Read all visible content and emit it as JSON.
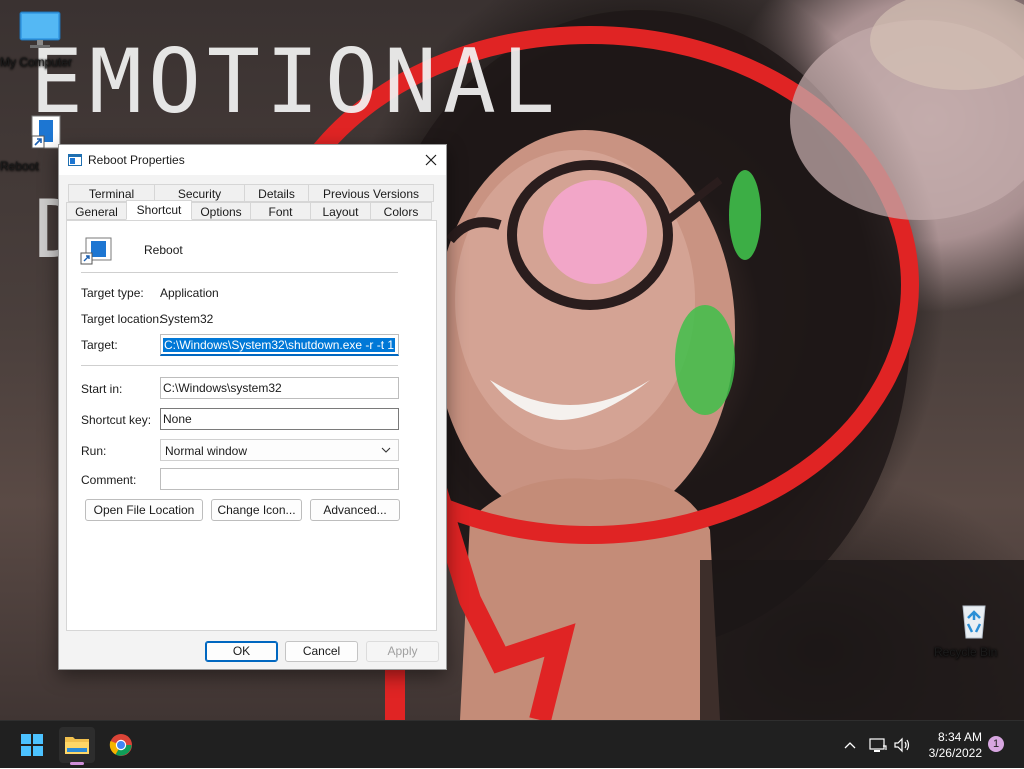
{
  "wallpaper": {
    "line1": "EMOTIONAL",
    "line2": "D"
  },
  "desktop": {
    "icons": [
      {
        "label": "My Computer",
        "icon": "monitor-icon"
      },
      {
        "label": "Reboot",
        "icon": "shortcut-icon"
      },
      {
        "label": "Recycle Bin",
        "icon": "recycle-bin-icon"
      }
    ]
  },
  "dialog": {
    "title": "Reboot Properties",
    "tabs_row1": [
      "Terminal",
      "Security",
      "Details",
      "Previous Versions"
    ],
    "tabs_row2": [
      "General",
      "Shortcut",
      "Options",
      "Font",
      "Layout",
      "Colors"
    ],
    "active_tab": "Shortcut",
    "shortcut_name": "Reboot",
    "target_type_label": "Target type:",
    "target_type_value": "Application",
    "target_location_label": "Target location:",
    "target_location_value": "System32",
    "target_label": "Target:",
    "target_value": "C:\\Windows\\System32\\shutdown.exe -r -t 1",
    "start_in_label": "Start in:",
    "start_in_value": "C:\\Windows\\system32",
    "shortcut_key_label": "Shortcut key:",
    "shortcut_key_value": "None",
    "run_label": "Run:",
    "run_value": "Normal window",
    "comment_label": "Comment:",
    "comment_value": "",
    "open_file_location": "Open File Location",
    "change_icon": "Change Icon...",
    "advanced": "Advanced...",
    "ok": "OK",
    "cancel": "Cancel",
    "apply": "Apply"
  },
  "taskbar": {
    "time": "8:34 AM",
    "date": "3/26/2022",
    "notification_count": "1"
  },
  "colors": {
    "accent": "#0067c0",
    "selection": "#0078d7",
    "taskbar": "#202020"
  }
}
